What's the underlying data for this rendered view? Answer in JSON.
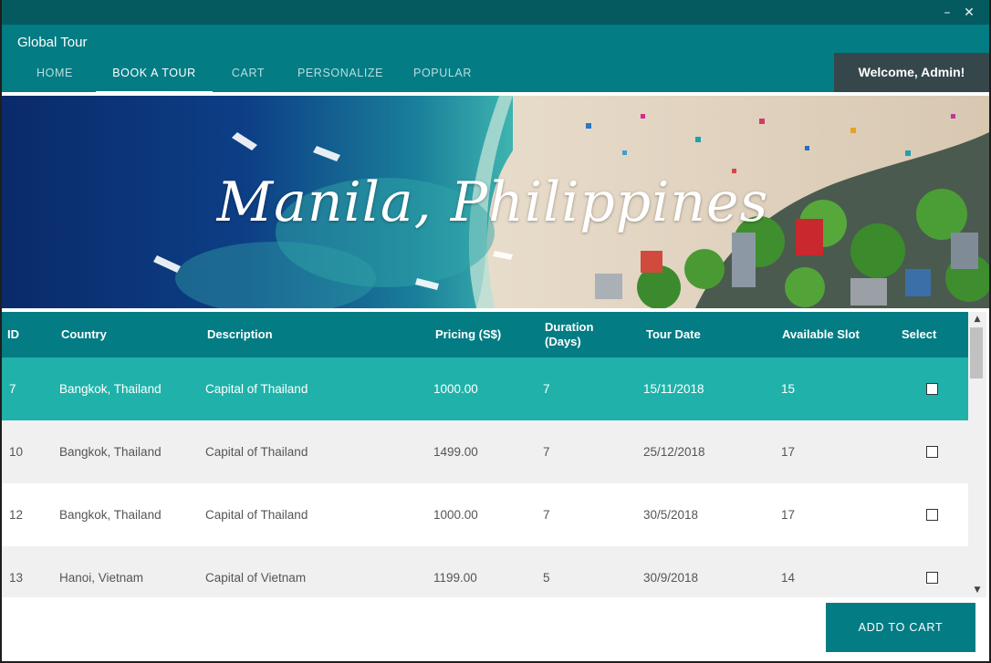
{
  "window": {
    "minimize_glyph": "–",
    "close_glyph": "✕"
  },
  "app": {
    "title": "Global Tour",
    "welcome": "Welcome, Admin!"
  },
  "nav": {
    "tabs": [
      {
        "label": "HOME",
        "active": false
      },
      {
        "label": "BOOK A TOUR",
        "active": true
      },
      {
        "label": "CART",
        "active": false
      },
      {
        "label": "PERSONALIZE",
        "active": false
      },
      {
        "label": "POPULAR",
        "active": false
      }
    ]
  },
  "banner": {
    "title": "Manila, Philippines"
  },
  "table": {
    "headers": {
      "id": "ID",
      "country": "Country",
      "description": "Description",
      "pricing": "Pricing (S$)",
      "duration_line1": "Duration",
      "duration_line2": "(Days)",
      "tour_date": "Tour Date",
      "available_slot": "Available Slot",
      "select": "Select"
    },
    "rows": [
      {
        "id": "7",
        "country": "Bangkok, Thailand",
        "description": "Capital of Thailand",
        "pricing": "1000.00",
        "duration": "7",
        "tour_date": "15/11/2018",
        "available_slot": "15",
        "selected": false
      },
      {
        "id": "10",
        "country": "Bangkok, Thailand",
        "description": "Capital of Thailand",
        "pricing": "1499.00",
        "duration": "7",
        "tour_date": "25/12/2018",
        "available_slot": "17",
        "selected": false
      },
      {
        "id": "12",
        "country": "Bangkok, Thailand",
        "description": "Capital of Thailand",
        "pricing": "1000.00",
        "duration": "7",
        "tour_date": "30/5/2018",
        "available_slot": "17",
        "selected": false
      },
      {
        "id": "13",
        "country": "Hanoi, Vietnam",
        "description": "Capital of Vietnam",
        "pricing": "1199.00",
        "duration": "5",
        "tour_date": "30/9/2018",
        "available_slot": "14",
        "selected": false
      }
    ]
  },
  "scrollbar": {
    "up_glyph": "▲",
    "down_glyph": "▼"
  },
  "footer": {
    "add_to_cart_label": "ADD TO CART"
  },
  "colors": {
    "titlebar": "#045a5f",
    "header": "#037c84",
    "selected_row": "#20b2aa",
    "alt_row": "#f0f0f0",
    "welcome_bg": "#36474c"
  }
}
